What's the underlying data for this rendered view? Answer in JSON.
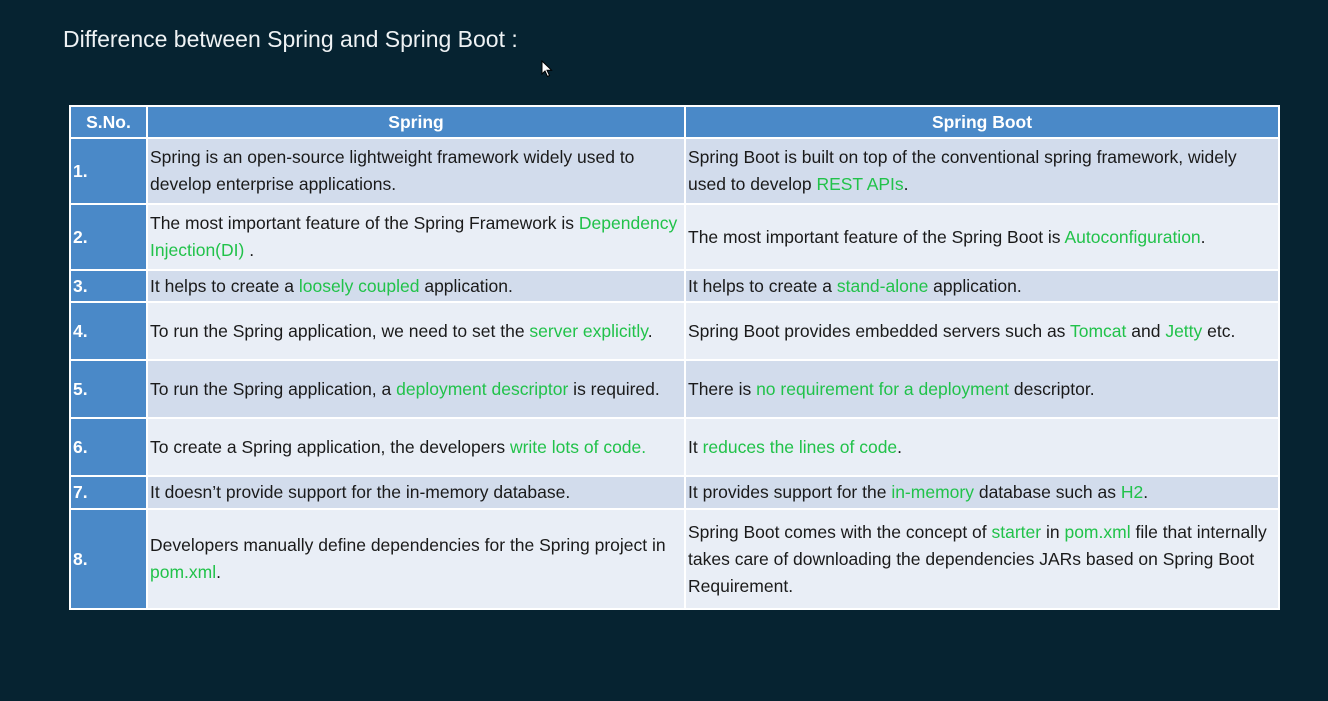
{
  "title": "Difference between Spring and Spring Boot :",
  "colors": {
    "background": "#062331",
    "header": "#4a89c8",
    "row_odd": "#d2dcec",
    "row_even": "#e9eef6",
    "highlight": "#21c24a"
  },
  "table": {
    "headers": [
      "S.No.",
      "Spring",
      "Spring Boot"
    ],
    "rows": [
      {
        "num": "1.",
        "spring": [
          [
            "Spring is an open-source lightweight framework widely used to develop enterprise applications.",
            false
          ]
        ],
        "boot": [
          [
            "Spring Boot is built on top of the conventional spring framework, widely used to develop ",
            false
          ],
          [
            "REST APIs",
            true
          ],
          [
            ".",
            false
          ]
        ]
      },
      {
        "num": "2.",
        "spring": [
          [
            "The most important feature of the Spring Framework is ",
            false
          ],
          [
            "Dependency Injection(DI)",
            true
          ],
          [
            " .",
            false
          ]
        ],
        "boot": [
          [
            "The most important feature of the Spring Boot is ",
            false
          ],
          [
            "Autoconfiguration",
            true
          ],
          [
            ".",
            false
          ]
        ]
      },
      {
        "num": "3.",
        "spring": [
          [
            "It helps to create a ",
            false
          ],
          [
            "loosely coupled",
            true
          ],
          [
            " application.",
            false
          ]
        ],
        "boot": [
          [
            "It helps to create a ",
            false
          ],
          [
            "stand-alone",
            true
          ],
          [
            " application.",
            false
          ]
        ]
      },
      {
        "num": "4.",
        "spring": [
          [
            "To run the Spring application, we need to set the ",
            false
          ],
          [
            "server explicitly",
            true
          ],
          [
            ".",
            false
          ]
        ],
        "boot": [
          [
            "Spring Boot provides embedded servers such as ",
            false
          ],
          [
            "Tomcat",
            true
          ],
          [
            " and ",
            false
          ],
          [
            "Jetty",
            true
          ],
          [
            " etc.",
            false
          ]
        ]
      },
      {
        "num": "5.",
        "spring": [
          [
            "To run the Spring application, a ",
            false
          ],
          [
            "deployment descriptor",
            true
          ],
          [
            " is required.",
            false
          ]
        ],
        "boot": [
          [
            "There is ",
            false
          ],
          [
            "no requirement for a deployment",
            true
          ],
          [
            " descriptor.",
            false
          ]
        ]
      },
      {
        "num": "6.",
        "spring": [
          [
            "To create a Spring application, the developers ",
            false
          ],
          [
            "write lots of code.",
            true
          ]
        ],
        "boot": [
          [
            "It ",
            false
          ],
          [
            "reduces the lines of code",
            true
          ],
          [
            ".",
            false
          ]
        ]
      },
      {
        "num": "7.",
        "spring": [
          [
            "It doesn’t provide support for the in-memory database.",
            false
          ]
        ],
        "boot": [
          [
            "It provides support for the ",
            false
          ],
          [
            "in-memory",
            true
          ],
          [
            " database such as ",
            false
          ],
          [
            "H2",
            true
          ],
          [
            ".",
            false
          ]
        ]
      },
      {
        "num": "8.",
        "spring": [
          [
            "Developers manually define dependencies for the Spring project in ",
            false
          ],
          [
            "pom.xml",
            true
          ],
          [
            ".",
            false
          ]
        ],
        "boot": [
          [
            "Spring Boot comes with the concept of ",
            false
          ],
          [
            "starter",
            true
          ],
          [
            " in ",
            false
          ],
          [
            "pom.xml",
            true
          ],
          [
            " file that internally takes care of downloading the dependencies JARs based on Spring Boot Requirement.",
            false
          ]
        ]
      }
    ]
  }
}
